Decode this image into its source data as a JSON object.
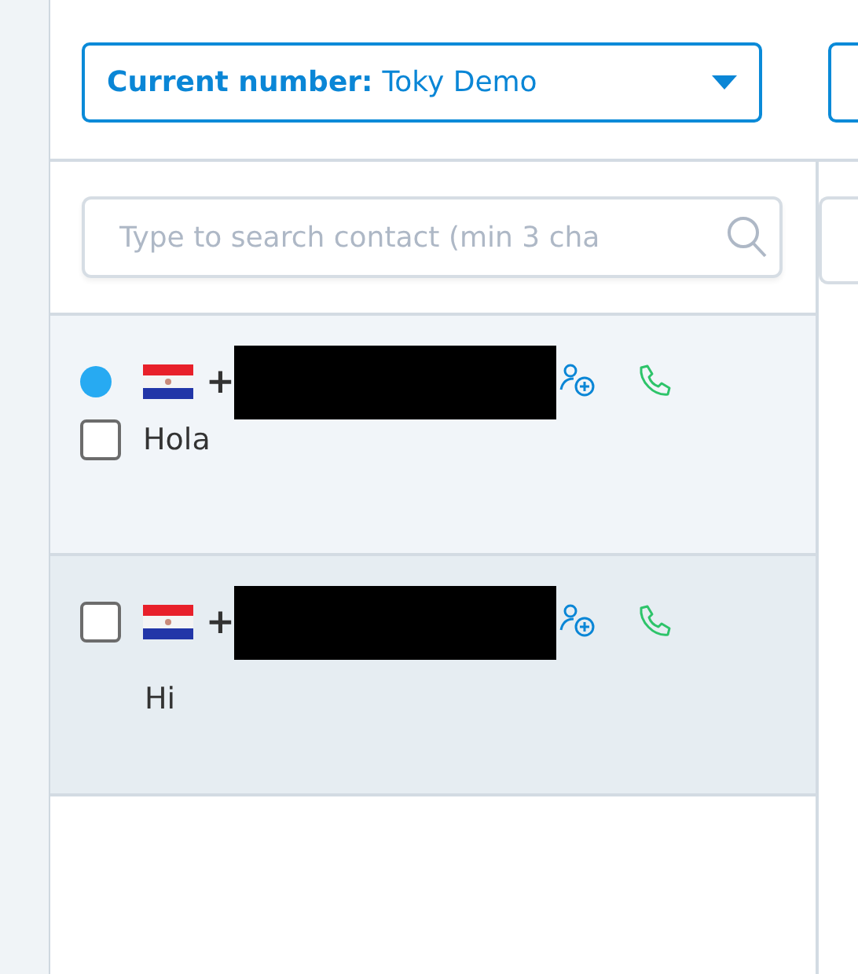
{
  "number_selector": {
    "label": "Current number:",
    "value": "Toky Demo"
  },
  "search": {
    "placeholder": "Type to search contact (min 3 cha"
  },
  "conversations": [
    {
      "unread": true,
      "checked": false,
      "prefix": "+",
      "message": "Hola"
    },
    {
      "unread": false,
      "checked": false,
      "prefix": "+",
      "message": "Hi"
    }
  ]
}
